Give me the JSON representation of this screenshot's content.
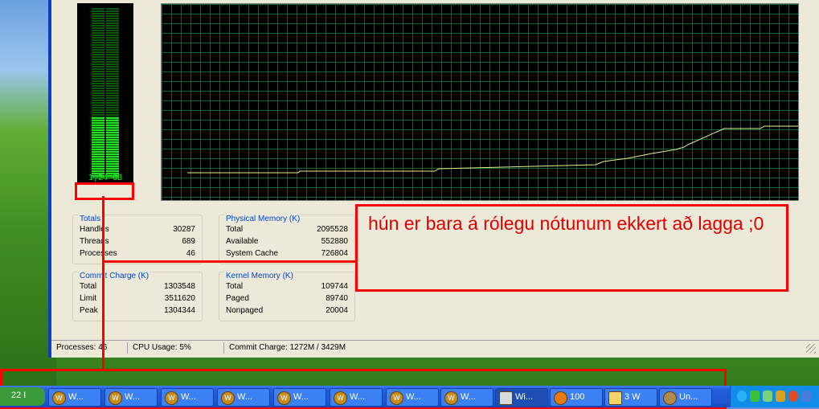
{
  "memory_usage_label": "1,24 GB",
  "memory_usage_fraction": 0.36,
  "totals": {
    "title": "Totals",
    "rows": [
      {
        "label": "Handles",
        "value": "30287"
      },
      {
        "label": "Threads",
        "value": "689"
      },
      {
        "label": "Processes",
        "value": "46"
      }
    ]
  },
  "physical_memory": {
    "title": "Physical Memory (K)",
    "rows": [
      {
        "label": "Total",
        "value": "2095528"
      },
      {
        "label": "Available",
        "value": "552880"
      },
      {
        "label": "System Cache",
        "value": "726804"
      }
    ]
  },
  "commit_charge": {
    "title": "Commit Charge (K)",
    "rows": [
      {
        "label": "Total",
        "value": "1303548"
      },
      {
        "label": "Limit",
        "value": "3511620"
      },
      {
        "label": "Peak",
        "value": "1304344"
      }
    ]
  },
  "kernel_memory": {
    "title": "Kernel Memory (K)",
    "rows": [
      {
        "label": "Total",
        "value": "109744"
      },
      {
        "label": "Paged",
        "value": "89740"
      },
      {
        "label": "Nonpaged",
        "value": "20004"
      }
    ]
  },
  "status": {
    "processes": "Processes: 46",
    "cpu": "CPU Usage: 5%",
    "commit": "Commit Charge: 1272M / 3429M"
  },
  "annotation": {
    "text": "hún er bara á rólegu nótunum ekkert að lagga ;0"
  },
  "colors": {
    "graph_line": "#e8f08a",
    "annotation": "#ff0000",
    "grid": "#006b2e"
  },
  "taskbar": {
    "start_label": "22 I",
    "buttons": [
      {
        "label": "W...",
        "icon": "wow-icon"
      },
      {
        "label": "W...",
        "icon": "wow-icon"
      },
      {
        "label": "W...",
        "icon": "wow-icon"
      },
      {
        "label": "W...",
        "icon": "wow-icon"
      },
      {
        "label": "W...",
        "icon": "wow-icon"
      },
      {
        "label": "W...",
        "icon": "wow-icon"
      },
      {
        "label": "W...",
        "icon": "wow-icon"
      },
      {
        "label": "W...",
        "icon": "wow-icon"
      },
      {
        "label": "Wi...",
        "icon": "task-manager-icon"
      },
      {
        "label": "100",
        "icon": "firefox-icon"
      },
      {
        "label": "3 W",
        "icon": "folder-icon"
      },
      {
        "label": "Un...",
        "icon": "app-icon"
      }
    ]
  }
}
